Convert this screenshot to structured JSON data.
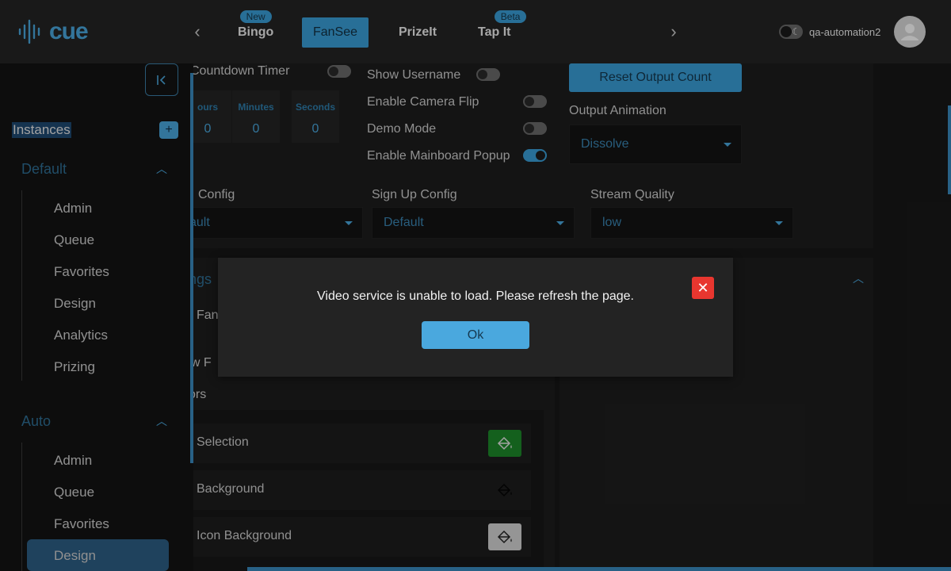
{
  "header": {
    "logo_text": "cue",
    "tabs": [
      {
        "label": "Bingo",
        "badge": "New"
      },
      {
        "label": "FanSee",
        "badge": ""
      },
      {
        "label": "PrizeIt",
        "badge": ""
      },
      {
        "label": "Tap It",
        "badge": "Beta"
      }
    ],
    "prev_arrow": "‹",
    "next_arrow": "›",
    "username": "qa-automation2"
  },
  "sidebar": {
    "instances_label": "Instances",
    "add_label": "+",
    "collapse_label": "|<",
    "groups": [
      {
        "title": "Default",
        "items": [
          "Admin",
          "Queue",
          "Favorites",
          "Design",
          "Analytics",
          "Prizing"
        ]
      },
      {
        "title": "Auto",
        "items": [
          "Admin",
          "Queue",
          "Favorites",
          "Design"
        ]
      }
    ]
  },
  "content": {
    "countdown_timer_label": "Countdown Timer",
    "timer": {
      "hours_label": "ours",
      "hours_value": "0",
      "minutes_label": "Minutes",
      "minutes_value": "0",
      "seconds_label": "Seconds",
      "seconds_value": "0"
    },
    "toggles": [
      {
        "label": "Show Username",
        "on": false
      },
      {
        "label": "Enable Camera Flip",
        "on": false
      },
      {
        "label": "Demo Mode",
        "on": false
      },
      {
        "label": "Enable Mainboard Popup",
        "on": true
      }
    ],
    "reset_button": "Reset Output Count",
    "output_animation_label": "Output Animation",
    "output_animation_value": "Dissolve",
    "config_label": "Config",
    "config_value": "ault",
    "signup_config_label": "Sign Up Config",
    "signup_config_value": "Default",
    "stream_quality_label": "Stream Quality",
    "stream_quality_value": "low",
    "partial_labels": [
      "ngs",
      "Fan",
      "ow F",
      "ors"
    ],
    "color_rows": [
      {
        "name": "Selection",
        "swatch_color": "#1e8a2a"
      },
      {
        "name": "Background",
        "swatch_color": "#1e1e1e"
      },
      {
        "name": "Icon Background",
        "swatch_color": "#d6d6d6"
      }
    ]
  },
  "modal": {
    "message": "Video service is unable to load. Please refresh the page.",
    "ok_label": "Ok",
    "close_label": "✕"
  },
  "colors": {
    "accent": "#3aa0d8",
    "danger": "#e8362f",
    "topbar": "#242424",
    "background": "#141414"
  }
}
